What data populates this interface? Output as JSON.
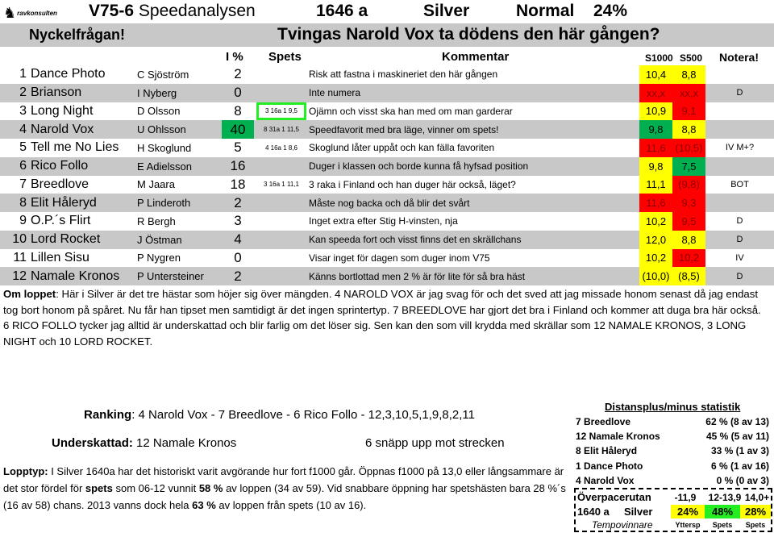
{
  "header": {
    "logo_text": "ravkonsulten",
    "race_code": "V75-6",
    "title": "Speedanalysen",
    "distance": "1646 a",
    "class": "Silver",
    "tempo": "Normal",
    "percent": "24%"
  },
  "key_question": {
    "label": "Nyckelfrågan!",
    "question": "Tvingas Narold Vox ta dödens den här gången?"
  },
  "columns": {
    "ip": "I %",
    "spets": "Spets",
    "kommentar": "Kommentar",
    "s1000": "S1000",
    "s500": "S500",
    "notera": "Notera!"
  },
  "rows": [
    {
      "num": "1",
      "horse": "Dance Photo",
      "driver": "C Sjöström",
      "ip": "2",
      "spets": "",
      "comment": "Risk att fastna i maskineriet den här gången",
      "s1000": "10,4",
      "s1000_color": "yellow",
      "s500": "8,8",
      "s500_color": "yellow",
      "note": ""
    },
    {
      "num": "2",
      "horse": "Brianson",
      "driver": "I Nyberg",
      "ip": "0",
      "spets": "",
      "comment": "Inte numera",
      "s1000": "xx,x",
      "s1000_color": "red",
      "s500": "xx,x",
      "s500_color": "red",
      "note": "D"
    },
    {
      "num": "3",
      "horse": "Long Night",
      "driver": "D Olsson",
      "ip": "8",
      "spets": "3 16a 1  9,5",
      "spets_boxed": true,
      "comment": "Ojämn och visst ska han med om man garderar",
      "s1000": "10,9",
      "s1000_color": "yellow",
      "s500": "9,1",
      "s500_color": "red",
      "note": ""
    },
    {
      "num": "4",
      "horse": "Narold Vox",
      "driver": "U Ohlsson",
      "ip": "40",
      "ip_highlight": true,
      "spets": "8 31a 1 11,5",
      "comment": "Speedfavorit med bra läge, vinner om spets!",
      "s1000": "9,8",
      "s1000_color": "green",
      "s500": "8,8",
      "s500_color": "yellow",
      "note": ""
    },
    {
      "num": "5",
      "horse": "Tell me No Lies",
      "driver": "H Skoglund",
      "ip": "5",
      "spets": "4 16a 1  8,6",
      "comment": "Skoglund låter uppåt och kan fälla favoriten",
      "s1000": "11,6",
      "s1000_color": "red",
      "s500": "(10,5)",
      "s500_color": "red",
      "note": "IV M+?"
    },
    {
      "num": "6",
      "horse": "Rico Follo",
      "driver": "E Adielsson",
      "ip": "16",
      "spets": "",
      "comment": "Duger i klassen och borde kunna få hyfsad position",
      "s1000": "9,8",
      "s1000_color": "yellow",
      "s500": "7,5",
      "s500_color": "green",
      "note": ""
    },
    {
      "num": "7",
      "horse": "Breedlove",
      "driver": "M Jaara",
      "ip": "18",
      "spets": "3 16a 1 11,1",
      "comment": "3 raka i Finland och han duger här också, läget?",
      "s1000": "11,1",
      "s1000_color": "yellow",
      "s500": "(9,8)",
      "s500_color": "red",
      "note": "BOT"
    },
    {
      "num": "8",
      "horse": "Elit Håleryd",
      "driver": "P Linderoth",
      "ip": "2",
      "spets": "",
      "comment": "Måste nog backa och då blir det svårt",
      "s1000": "11,6",
      "s1000_color": "red",
      "s500": "9,3",
      "s500_color": "red",
      "note": ""
    },
    {
      "num": "9",
      "horse": "O.P.´s Flirt",
      "driver": "R Bergh",
      "ip": "3",
      "spets": "",
      "comment": "Inget extra efter Stig H-vinsten, nja",
      "s1000": "10,2",
      "s1000_color": "yellow",
      "s500": "9,5",
      "s500_color": "red",
      "note": "D"
    },
    {
      "num": "10",
      "horse": "Lord Rocket",
      "driver": "J Östman",
      "ip": "4",
      "spets": "",
      "comment": "Kan speeda fort och visst finns det en skrällchans",
      "s1000": "12,0",
      "s1000_color": "yellow",
      "s500": "8,8",
      "s500_color": "yellow",
      "note": "D"
    },
    {
      "num": "11",
      "horse": "Lillen Sisu",
      "driver": "P Nygren",
      "ip": "0",
      "spets": "",
      "comment": "Visar inget för dagen som duger inom V75",
      "s1000": "10,2",
      "s1000_color": "yellow",
      "s500": "10,2",
      "s500_color": "red",
      "note": "IV"
    },
    {
      "num": "12",
      "horse": "Namale Kronos",
      "driver": "P Untersteiner",
      "ip": "2",
      "spets": "",
      "comment": "Känns bortlottad men 2 % är för lite för så bra häst",
      "s1000": "(10,0)",
      "s1000_color": "yellow",
      "s500": "(8,5)",
      "s500_color": "yellow",
      "note": "D"
    }
  ],
  "om_loppet": {
    "label": "Om loppet",
    "text": ": Här i Silver är det tre hästar som höjer sig över mängden. 4 NAROLD VOX är jag svag för och det sved att jag missade honom senast då jag endast tog bort honom på spåret. Nu får han tipset men samtidigt är det ingen sprintertyp. 7 BREEDLOVE har gjort det bra i Finland och kommer att duga bra här också. 6 RICO FOLLO tycker jag alltid är underskattad och blir farlig om det löser sig. Sen kan den som vill krydda med skrällar som 12 NAMALE KRONOS, 3 LONG NIGHT och 10 LORD ROCKET."
  },
  "ranking": {
    "label": "Ranking",
    "text": ": 4 Narold Vox - 7 Breedlove - 6 Rico Follo - 12,3,10,5,1,9,8,2,11"
  },
  "underskattad": {
    "label": "Underskattad:",
    "text": " 12 Namale Kronos",
    "note": "6 snäpp upp mot strecken"
  },
  "lopptyp": {
    "label": "Lopptyp:",
    "p1": " I Silver 1640a har det historiskt varit avgörande hur fort f1000 går. Öppnas f1000 på 13,0 eller långsammare är det stor fördel för ",
    "b1": "spets",
    "p2": " som 06-12 vunnit ",
    "b2": "58 %",
    "p3": " av loppen (34 av 59). Vid snabbare öppning har spetshästen bara 28 %´s (16 av 58) chans. 2013 vanns dock hela ",
    "b3": "63 %",
    "p4": " av loppen från spets (10 av 16)."
  },
  "distans": {
    "title": "Distansplus/minus statistik",
    "items": [
      {
        "name": "7 Breedlove",
        "value": "62 % (8 av 13)"
      },
      {
        "name": "12 Namale Kronos",
        "value": "45 % (5 av 11)"
      },
      {
        "name": "8 Elit Håleryd",
        "value": "33 % (1 av 3)"
      },
      {
        "name": "1 Dance Photo",
        "value": "6 % (1 av 16)"
      },
      {
        "name": "4 Narold Vox",
        "value": "0 % (0 av 3)"
      }
    ]
  },
  "overpace": {
    "title": "Överpacerutan",
    "ranges": [
      "-11,9",
      "12-13,9",
      "14,0+"
    ],
    "distance": "1640 a",
    "class": "Silver",
    "values": [
      "24%",
      "48%",
      "28%"
    ],
    "value_colors": [
      "yellow",
      "green",
      "yellow"
    ],
    "subtitle": "Tempovinnare",
    "winners": [
      "Yttersp",
      "Spets",
      "Spets"
    ]
  },
  "colors": {
    "yellow": "#ffff00",
    "red": "#ff0000",
    "green": "#00b050",
    "bright_green": "#22ee22",
    "row_grey": "#c8c8c8"
  }
}
